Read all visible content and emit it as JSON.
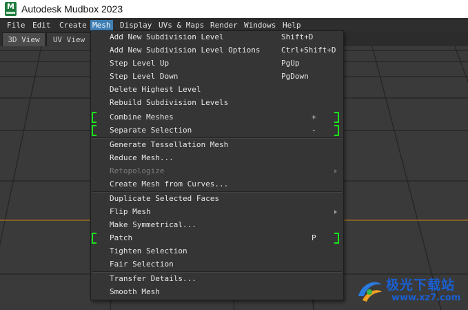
{
  "window": {
    "title": "Autodesk Mudbox 2023"
  },
  "menubar": {
    "items": [
      "File",
      "Edit",
      "Create",
      "Mesh",
      "Display",
      "UVs & Maps",
      "Render",
      "Windows",
      "Help"
    ],
    "active": "Mesh"
  },
  "tabs": [
    "3D View",
    "UV View"
  ],
  "mesh_menu": {
    "items": [
      {
        "label": "Add New Subdivision Level",
        "shortcut": "Shift+D"
      },
      {
        "label": "Add New Subdivision Level Options",
        "shortcut": "Ctrl+Shift+D"
      },
      {
        "label": "Step Level Up",
        "shortcut": "PgUp"
      },
      {
        "label": "Step Level Down",
        "shortcut": "PgDown"
      },
      {
        "label": "Delete Highest Level",
        "shortcut": ""
      },
      {
        "label": "Rebuild Subdivision Levels",
        "shortcut": ""
      },
      {
        "label": "Combine Meshes",
        "shortcut": "+"
      },
      {
        "label": "Separate Selection",
        "shortcut": "-"
      },
      {
        "label": "Generate Tessellation Mesh",
        "shortcut": ""
      },
      {
        "label": "Reduce Mesh...",
        "shortcut": ""
      },
      {
        "label": "Retopologize",
        "shortcut": "",
        "disabled": true,
        "submenu": true
      },
      {
        "label": "Create Mesh from Curves...",
        "shortcut": ""
      },
      {
        "label": "Duplicate Selected Faces",
        "shortcut": ""
      },
      {
        "label": "Flip Mesh",
        "shortcut": "",
        "submenu": true
      },
      {
        "label": "Make Symmetrical...",
        "shortcut": ""
      },
      {
        "label": "Patch",
        "shortcut": "P"
      },
      {
        "label": "Tighten Selection",
        "shortcut": ""
      },
      {
        "label": "Fair Selection",
        "shortcut": ""
      },
      {
        "label": "Transfer Details...",
        "shortcut": ""
      },
      {
        "label": "Smooth Mesh",
        "shortcut": ""
      }
    ]
  },
  "watermark": {
    "title": "极光下载站",
    "url": "www.xz7.com"
  },
  "colors": {
    "menu_highlight": "#3f7fb4",
    "highlight_bracket": "#19e61c",
    "watermark": "#1a5fd1"
  }
}
